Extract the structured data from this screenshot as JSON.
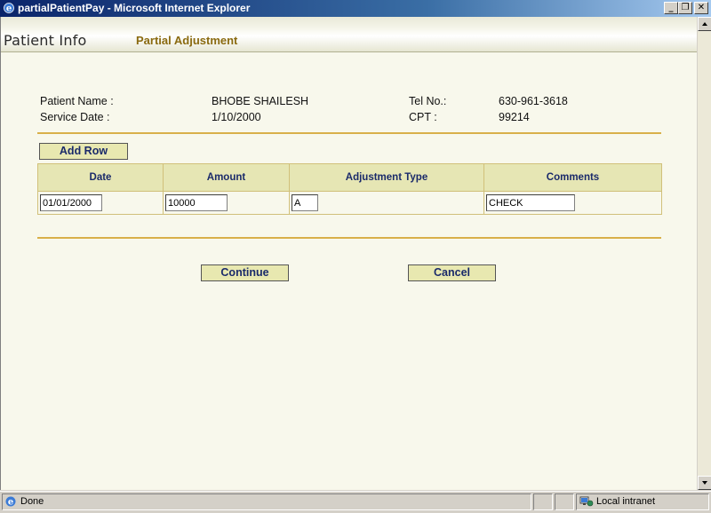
{
  "window": {
    "title": "partialPatientPay - Microsoft Internet Explorer",
    "minimize_glyph": "_",
    "restore_glyph": "❐",
    "close_glyph": "✕"
  },
  "header": {
    "title": "Patient Info",
    "subtitle": "Partial Adjustment"
  },
  "patient": {
    "name_label": "Patient Name :",
    "name_value": "BHOBE SHAILESH",
    "service_date_label": "Service Date :",
    "service_date_value": "1/10/2000",
    "tel_label": "Tel No.:",
    "tel_value": "630-961-3618",
    "cpt_label": "CPT :",
    "cpt_value": "99214"
  },
  "actions": {
    "add_row": "Add Row",
    "continue": "Continue",
    "cancel": "Cancel"
  },
  "grid": {
    "headers": [
      "Date",
      "Amount",
      "Adjustment Type",
      "Comments"
    ],
    "rows": [
      {
        "date": "01/01/2000",
        "amount": "10000",
        "adjustment_type": "A",
        "comments": "CHECK"
      }
    ]
  },
  "statusbar": {
    "status": "Done",
    "zone": "Local intranet"
  },
  "colors": {
    "page_background": "#f8f8ec",
    "accent_rule": "#d9b04a",
    "header_cell": "#e6e6b4",
    "title_bar": "#0a246a"
  },
  "icons": {
    "app": "ie-icon",
    "zone": "intranet-icon"
  }
}
